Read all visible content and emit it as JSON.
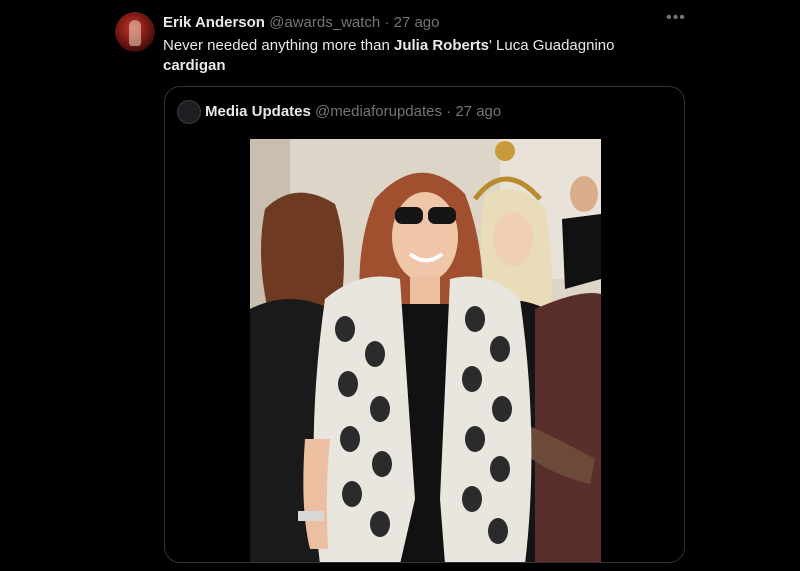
{
  "tweet": {
    "author_name": "Erik Anderson",
    "author_handle": "@awards_watch",
    "separator": "·",
    "time": "27 ago",
    "more_icon": "more-horizontal-icon",
    "text_parts": [
      "Never needed anything more than ",
      "Julia Roberts",
      "' Luca Guadagnino ",
      "cardigan"
    ]
  },
  "quoted": {
    "author_name": "Media Updates",
    "author_handle": "@mediaforupdates",
    "separator": "·",
    "time": "27 ago"
  },
  "colors": {
    "background": "#000000",
    "text": "#e7e9ea",
    "muted": "#71767b",
    "border": "#2f3336"
  }
}
